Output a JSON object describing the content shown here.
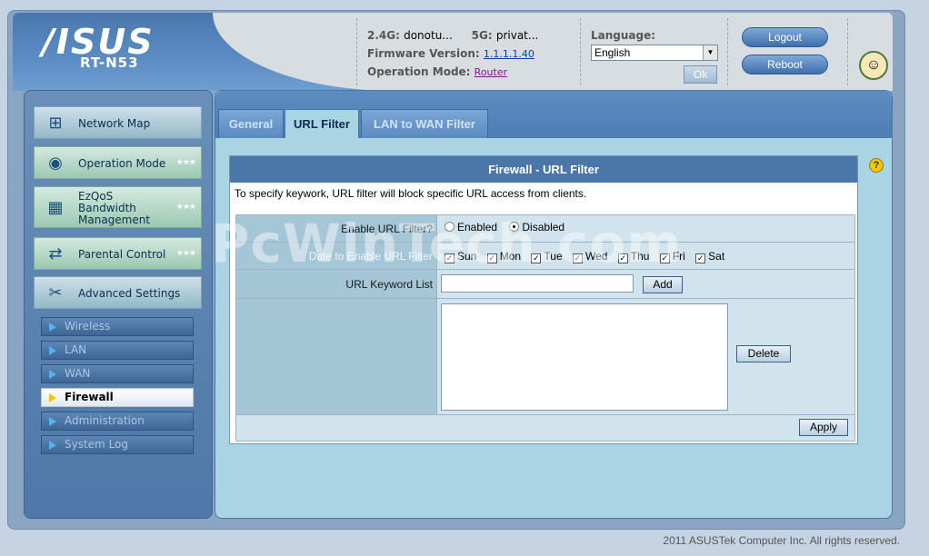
{
  "header": {
    "brand": "/ISUS",
    "model": "RT-N53",
    "ssid_24_label": "2.4G:",
    "ssid_24_value": "donotu...",
    "ssid_5_label": "5G:",
    "ssid_5_value": "privat...",
    "firmware_label": "Firmware Version:",
    "firmware_value": "1.1.1.1.40",
    "opmode_label": "Operation Mode:",
    "opmode_value": "Router",
    "language_label": "Language:",
    "language_value": "English",
    "ok_label": "Ok",
    "logout_label": "Logout",
    "reboot_label": "Reboot"
  },
  "sidebar": {
    "items": [
      {
        "label": "Network Map"
      },
      {
        "label": "Operation Mode"
      },
      {
        "label_1": "EzQoS",
        "label_2": "Bandwidth",
        "label_3": "Management"
      },
      {
        "label": "Parental Control"
      },
      {
        "label": "Advanced Settings"
      }
    ],
    "sub_items": [
      {
        "label": "Wireless"
      },
      {
        "label": "LAN"
      },
      {
        "label": "WAN"
      },
      {
        "label": "Firewall"
      },
      {
        "label": "Administration"
      },
      {
        "label": "System Log"
      }
    ]
  },
  "tabs": [
    {
      "label": "General"
    },
    {
      "label": "URL Filter"
    },
    {
      "label": "LAN to WAN Filter"
    }
  ],
  "panel": {
    "title": "Firewall - URL Filter",
    "description": "To specify keywork, URL filter will block specific URL access from clients.",
    "enable_label": "Enable URL Filter?",
    "enabled_option": "Enabled",
    "disabled_option": "Disabled",
    "date_label": "Date to Enable URL Filter",
    "days": [
      "Sun",
      "Mon",
      "Tue",
      "Wed",
      "Thu",
      "Fri",
      "Sat"
    ],
    "keyword_label": "URL Keyword List",
    "keyword_value": "",
    "add_label": "Add",
    "delete_label": "Delete",
    "apply_label": "Apply"
  },
  "watermark": "PcWinTech.com",
  "help_icon": "?",
  "footer": "2011 ASUSTek Computer Inc. All rights reserved."
}
